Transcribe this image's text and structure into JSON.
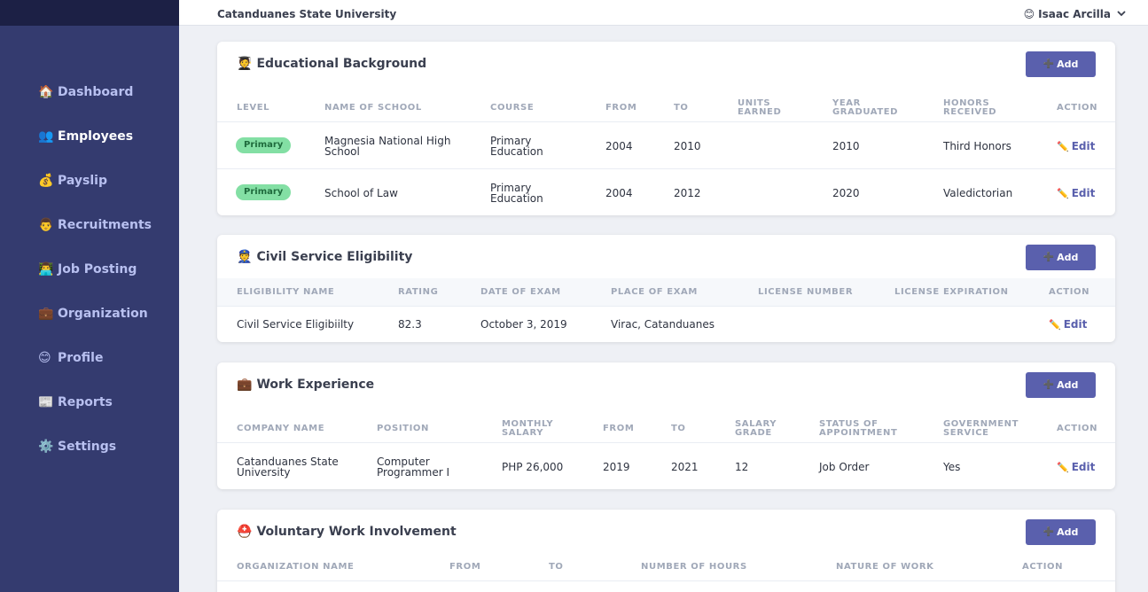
{
  "header": {
    "org_name": "Catanduanes State University",
    "user_name": "Isaac Arcilla",
    "user_icon": "😊"
  },
  "sidebar": {
    "items": [
      {
        "icon": "🏠",
        "label": "Dashboard"
      },
      {
        "icon": "👥",
        "label": "Employees"
      },
      {
        "icon": "💰",
        "label": "Payslip"
      },
      {
        "icon": "👨",
        "label": "Recruitments"
      },
      {
        "icon": "👨‍💻",
        "label": "Job Posting"
      },
      {
        "icon": "💼",
        "label": "Organization"
      },
      {
        "icon": "😊",
        "label": "Profile"
      },
      {
        "icon": "📰",
        "label": "Reports"
      },
      {
        "icon": "⚙️",
        "label": "Settings"
      }
    ]
  },
  "add_label": "Add",
  "edit_label": "Edit",
  "education": {
    "title": "Educational Background",
    "icon": "🧑‍🎓",
    "headers": [
      "LEVEL",
      "NAME OF SCHOOL",
      "COURSE",
      "FROM",
      "TO",
      "UNITS EARNED",
      "YEAR GRADUATED",
      "HONORS RECEIVED",
      "ACTION"
    ],
    "rows": [
      {
        "level": "Primary",
        "school": "Magnesia National High School",
        "course": "Primary Education",
        "from": "2004",
        "to": "2010",
        "units": "",
        "year": "2010",
        "honors": "Third Honors"
      },
      {
        "level": "Primary",
        "school": "School of Law",
        "course": "Primary Education",
        "from": "2004",
        "to": "2012",
        "units": "",
        "year": "2020",
        "honors": "Valedictorian"
      }
    ]
  },
  "civil": {
    "title": "Civil Service Eligibility",
    "icon": "👮",
    "headers": [
      "ELIGIBILITY NAME",
      "RATING",
      "DATE OF EXAM",
      "PLACE OF EXAM",
      "LICENSE NUMBER",
      "LICENSE EXPIRATION",
      "ACTION"
    ],
    "rows": [
      {
        "name": "Civil Service Eligibiilty",
        "rating": "82.3",
        "date": "October 3, 2019",
        "place": "Virac, Catanduanes",
        "license": "",
        "expiration": ""
      }
    ]
  },
  "work": {
    "title": "Work Experience",
    "icon": "💼",
    "headers": [
      "COMPANY NAME",
      "POSITION",
      "MONTHLY SALARY",
      "FROM",
      "TO",
      "SALARY GRADE",
      "STATUS OF APPOINTMENT",
      "GOVERNMENT SERVICE",
      "ACTION"
    ],
    "rows": [
      {
        "company": "Catanduanes State University",
        "position": "Computer Programmer I",
        "salary": "PHP 26,000",
        "from": "2019",
        "to": "2021",
        "grade": "12",
        "status": "Job Order",
        "gov": "Yes"
      }
    ]
  },
  "voluntary": {
    "title": "Voluntary Work Involvement",
    "icon": "⛑️",
    "headers": [
      "ORGANIZATION NAME",
      "FROM",
      "TO",
      "NUMBER OF HOURS",
      "NATURE OF WORK",
      "ACTION"
    ]
  }
}
